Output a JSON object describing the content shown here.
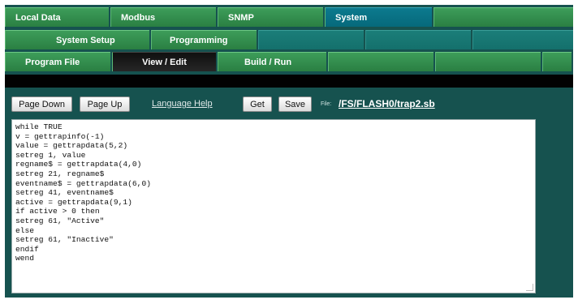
{
  "tabs_row1": [
    "Local Data",
    "Modbus",
    "SNMP",
    "System",
    ""
  ],
  "tabs_row2": [
    "System Setup",
    "Programming",
    "",
    "",
    ""
  ],
  "tabs_row3": [
    "Program File",
    "View / Edit",
    "Build / Run",
    "",
    "",
    ""
  ],
  "toolbar": {
    "page_down": "Page Down",
    "page_up": "Page Up",
    "language_help": "Language Help",
    "get": "Get",
    "save": "Save",
    "file_label": "File:",
    "file_path": "/FS/FLASH0/trap2.sb"
  },
  "editor": {
    "code": "while TRUE\nv = gettrapinfo(-1)\nvalue = gettrapdata(5,2)\nsetreg 1, value\nregname$ = gettrapdata(4,0)\nsetreg 21, regname$\neventname$ = gettrapdata(6,0)\nsetreg 41, eventname$\nactive = gettrapdata(9,1)\nif active > 0 then\nsetreg 61, \"Active\"\nelse\nsetreg 61, \"Inactive\"\nendif\nwend"
  }
}
